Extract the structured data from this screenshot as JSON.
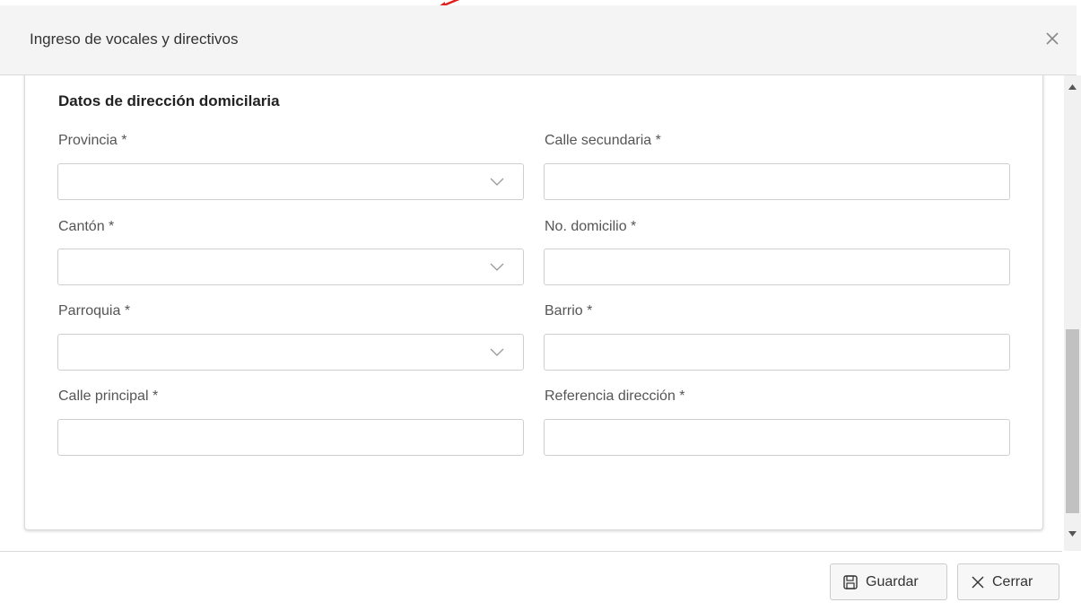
{
  "dialog": {
    "title": "Ingreso de vocales y directivos",
    "close_icon": "close-icon"
  },
  "section": {
    "title": "Datos de dirección domicilaria"
  },
  "fields": {
    "provincia": {
      "label": "Provincia *",
      "value": ""
    },
    "canton": {
      "label": "Cantón *",
      "value": ""
    },
    "parroquia": {
      "label": "Parroquia *",
      "value": ""
    },
    "calle_principal": {
      "label": "Calle principal *",
      "value": ""
    },
    "calle_secundaria": {
      "label": "Calle secundaria *",
      "value": ""
    },
    "no_domicilio": {
      "label": "No. domicilio *",
      "value": ""
    },
    "barrio": {
      "label": "Barrio *",
      "value": ""
    },
    "referencia": {
      "label": "Referencia dirección *",
      "value": ""
    }
  },
  "footer": {
    "save_label": "Guardar",
    "save_icon": "floppy-disk-icon",
    "close_label": "Cerrar",
    "close_icon": "x-icon"
  },
  "colors": {
    "header_bg": "#f4f4f4",
    "border": "#cfcfcf",
    "annotation_arrow": "#e02020"
  }
}
